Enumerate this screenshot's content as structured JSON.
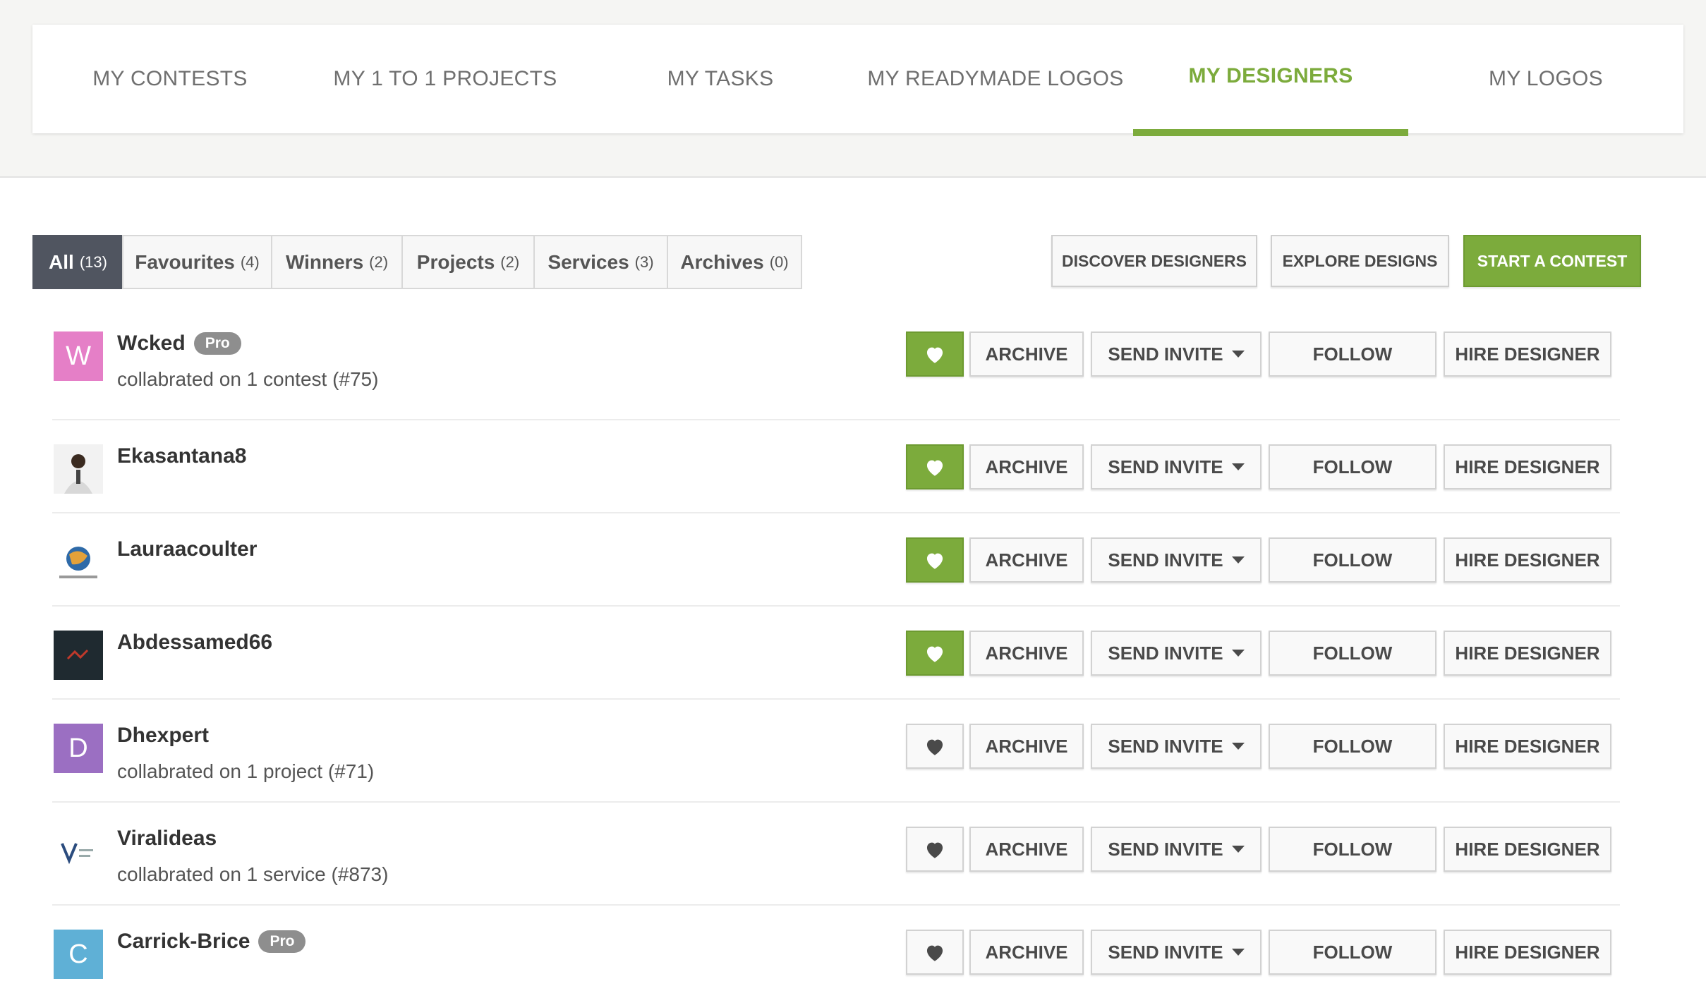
{
  "nav": {
    "tabs": [
      {
        "label": "MY CONTESTS"
      },
      {
        "label": "MY 1 TO 1 PROJECTS"
      },
      {
        "label": "MY TASKS"
      },
      {
        "label": "MY READYMADE LOGOS"
      },
      {
        "label": "MY DESIGNERS",
        "active": true
      },
      {
        "label": "MY LOGOS"
      }
    ]
  },
  "filters": [
    {
      "label": "All",
      "count": "(13)",
      "active": true
    },
    {
      "label": "Favourites",
      "count": "(4)"
    },
    {
      "label": "Winners",
      "count": "(2)"
    },
    {
      "label": "Projects",
      "count": "(2)"
    },
    {
      "label": "Services",
      "count": "(3)"
    },
    {
      "label": "Archives",
      "count": "(0)"
    }
  ],
  "actions": {
    "discover": "DISCOVER DESIGNERS",
    "explore": "EXPLORE DESIGNS",
    "start": "START A CONTEST"
  },
  "row_buttons": {
    "archive": "ARCHIVE",
    "send_invite": "SEND INVITE",
    "follow": "FOLLOW",
    "hire": "HIRE DESIGNER"
  },
  "pro_label": "Pro",
  "designers": [
    {
      "name": "Wcked",
      "pro": true,
      "collab": "collabrated on 1 contest (#75)",
      "favourite": true,
      "avatar_letter": "W",
      "avatar_color": "#e57fc7"
    },
    {
      "name": "Ekasantana8",
      "pro": false,
      "collab": "",
      "favourite": true,
      "avatar_letter": "",
      "avatar_color": "#f2f2f2"
    },
    {
      "name": "Lauraacoulter",
      "pro": false,
      "collab": "",
      "favourite": true,
      "avatar_letter": "",
      "avatar_color": "#ffffff"
    },
    {
      "name": "Abdessamed66",
      "pro": false,
      "collab": "",
      "favourite": true,
      "avatar_letter": "",
      "avatar_color": "#1f2a30"
    },
    {
      "name": "Dhexpert",
      "pro": false,
      "collab": "collabrated on 1 project (#71)",
      "favourite": false,
      "avatar_letter": "D",
      "avatar_color": "#9b6fc2"
    },
    {
      "name": "Viralideas",
      "pro": false,
      "collab": "collabrated on 1 service (#873)",
      "favourite": false,
      "avatar_letter": "",
      "avatar_color": "#ffffff"
    },
    {
      "name": "Carrick-Brice",
      "pro": true,
      "collab": "",
      "favourite": false,
      "avatar_letter": "C",
      "avatar_color": "#5fb0d6"
    }
  ],
  "colors": {
    "accent": "#7cab3c",
    "active_filter": "#505560"
  }
}
